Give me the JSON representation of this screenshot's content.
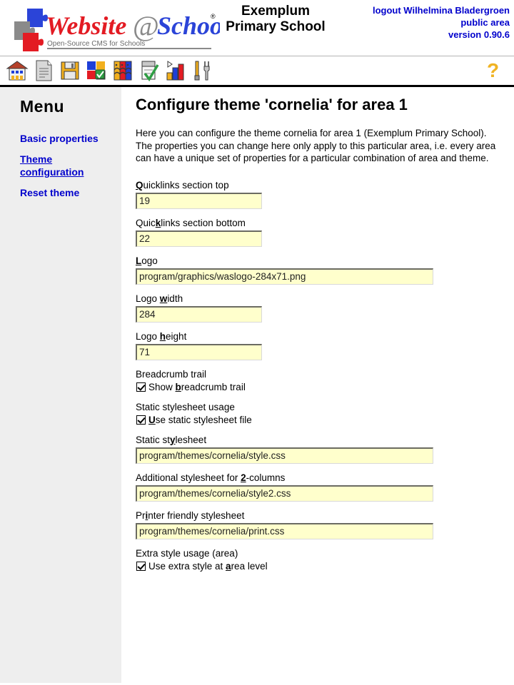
{
  "header": {
    "logo": {
      "name": "website-at-school-logo",
      "word1": "Website",
      "at": "@",
      "word2": "School",
      "registered": "®",
      "tagline": "Open-Source CMS for Schools"
    },
    "school_title_line1": "Exemplum",
    "school_title_line2": "Primary School",
    "logout_text": "logout Wilhelmina Bladergroen",
    "area_text": "public area",
    "version_text": "version 0.90.6"
  },
  "toolbar": {
    "icons": [
      {
        "name": "home-icon",
        "label": "Home"
      },
      {
        "name": "page-icon",
        "label": "Pages"
      },
      {
        "name": "save-floppy-icon",
        "label": "File manager"
      },
      {
        "name": "modules-puzzle-icon",
        "label": "Modules"
      },
      {
        "name": "users-faces-icon",
        "label": "Users"
      },
      {
        "name": "checklist-icon",
        "label": "Approval"
      },
      {
        "name": "statistics-bars-icon",
        "label": "Statistics"
      },
      {
        "name": "tools-icon",
        "label": "Tools"
      }
    ],
    "help_icon_label": "?"
  },
  "sidebar": {
    "title": "Menu",
    "items": [
      {
        "label": "Basic properties",
        "current": false
      },
      {
        "label": "Theme configuration",
        "current": true
      },
      {
        "label": "Reset theme",
        "current": false
      }
    ]
  },
  "main": {
    "page_title": "Configure theme 'cornelia' for area 1",
    "intro_line1": "Here you can configure the theme cornelia for area 1 (Exemplum Primary School).",
    "intro_line2": "The properties you can change here only apply to this particular area, i.e. every area can have a unique set of properties for a particular combination of area and theme.",
    "fields": [
      {
        "type": "text",
        "name": "quicklinks-section-top",
        "label_pre": "",
        "label_key": "Q",
        "label_post": "uicklinks section top",
        "value": "19",
        "size": "short"
      },
      {
        "type": "text",
        "name": "quicklinks-section-bottom",
        "label_pre": "Quic",
        "label_key": "k",
        "label_post": "links section bottom",
        "value": "22",
        "size": "short"
      },
      {
        "type": "text",
        "name": "logo",
        "label_pre": "",
        "label_key": "L",
        "label_post": "ogo",
        "value": "program/graphics/waslogo-284x71.png",
        "size": "long"
      },
      {
        "type": "text",
        "name": "logo-width",
        "label_pre": "Logo ",
        "label_key": "w",
        "label_post": "idth",
        "value": "284",
        "size": "short"
      },
      {
        "type": "text",
        "name": "logo-height",
        "label_pre": "Logo ",
        "label_key": "h",
        "label_post": "eight",
        "value": "71",
        "size": "short"
      },
      {
        "type": "checkbox",
        "name": "breadcrumb-trail",
        "caption": "Breadcrumb trail",
        "label_pre": "Show ",
        "label_key": "b",
        "label_post": "readcrumb trail",
        "checked": true
      },
      {
        "type": "checkbox",
        "name": "static-stylesheet-usage",
        "caption": "Static stylesheet usage",
        "label_pre": "",
        "label_key": "U",
        "label_post": "se static stylesheet file",
        "checked": true
      },
      {
        "type": "text",
        "name": "static-stylesheet",
        "label_pre": "Static st",
        "label_key": "y",
        "label_post": "lesheet",
        "value": "program/themes/cornelia/style.css",
        "size": "long"
      },
      {
        "type": "text",
        "name": "additional-stylesheet-2-columns",
        "label_pre": "Additional stylesheet for ",
        "label_key": "2",
        "label_post": "-columns",
        "value": "program/themes/cornelia/style2.css",
        "size": "long"
      },
      {
        "type": "text",
        "name": "printer-friendly-stylesheet",
        "label_pre": "Pr",
        "label_key": "i",
        "label_post": "nter friendly stylesheet",
        "value": "program/themes/cornelia/print.css",
        "size": "long"
      },
      {
        "type": "checkbox",
        "name": "extra-style-usage-area",
        "caption": "Extra style usage (area)",
        "label_pre": "Use extra style at ",
        "label_key": "a",
        "label_post": "rea level",
        "checked": true
      }
    ]
  },
  "colors": {
    "link": "#0000cc",
    "sidebar_bg": "#eeeeee",
    "input_bg": "#ffffcc",
    "logo_red": "#e31b23",
    "logo_blue": "#1f3fd8",
    "logo_gray": "#808080",
    "help_yellow": "#f0b323"
  }
}
